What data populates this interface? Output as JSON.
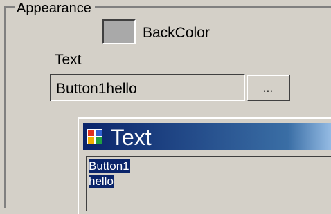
{
  "appearance": {
    "group_title": "Appearance",
    "backcolor_label": "BackColor",
    "backcolor_value": "#a9a9a9",
    "text_label": "Text",
    "text_value": "Button1hello",
    "ellipsis_label": "..."
  },
  "dialog": {
    "title": "Text",
    "lines": [
      "Button1",
      "hello"
    ]
  },
  "colors": {
    "background": "#d4d0c8",
    "titlebar_start": "#0a246a",
    "titlebar_end": "#a6caf0",
    "selection": "#0a246a"
  },
  "icons": [
    "app-icon"
  ]
}
